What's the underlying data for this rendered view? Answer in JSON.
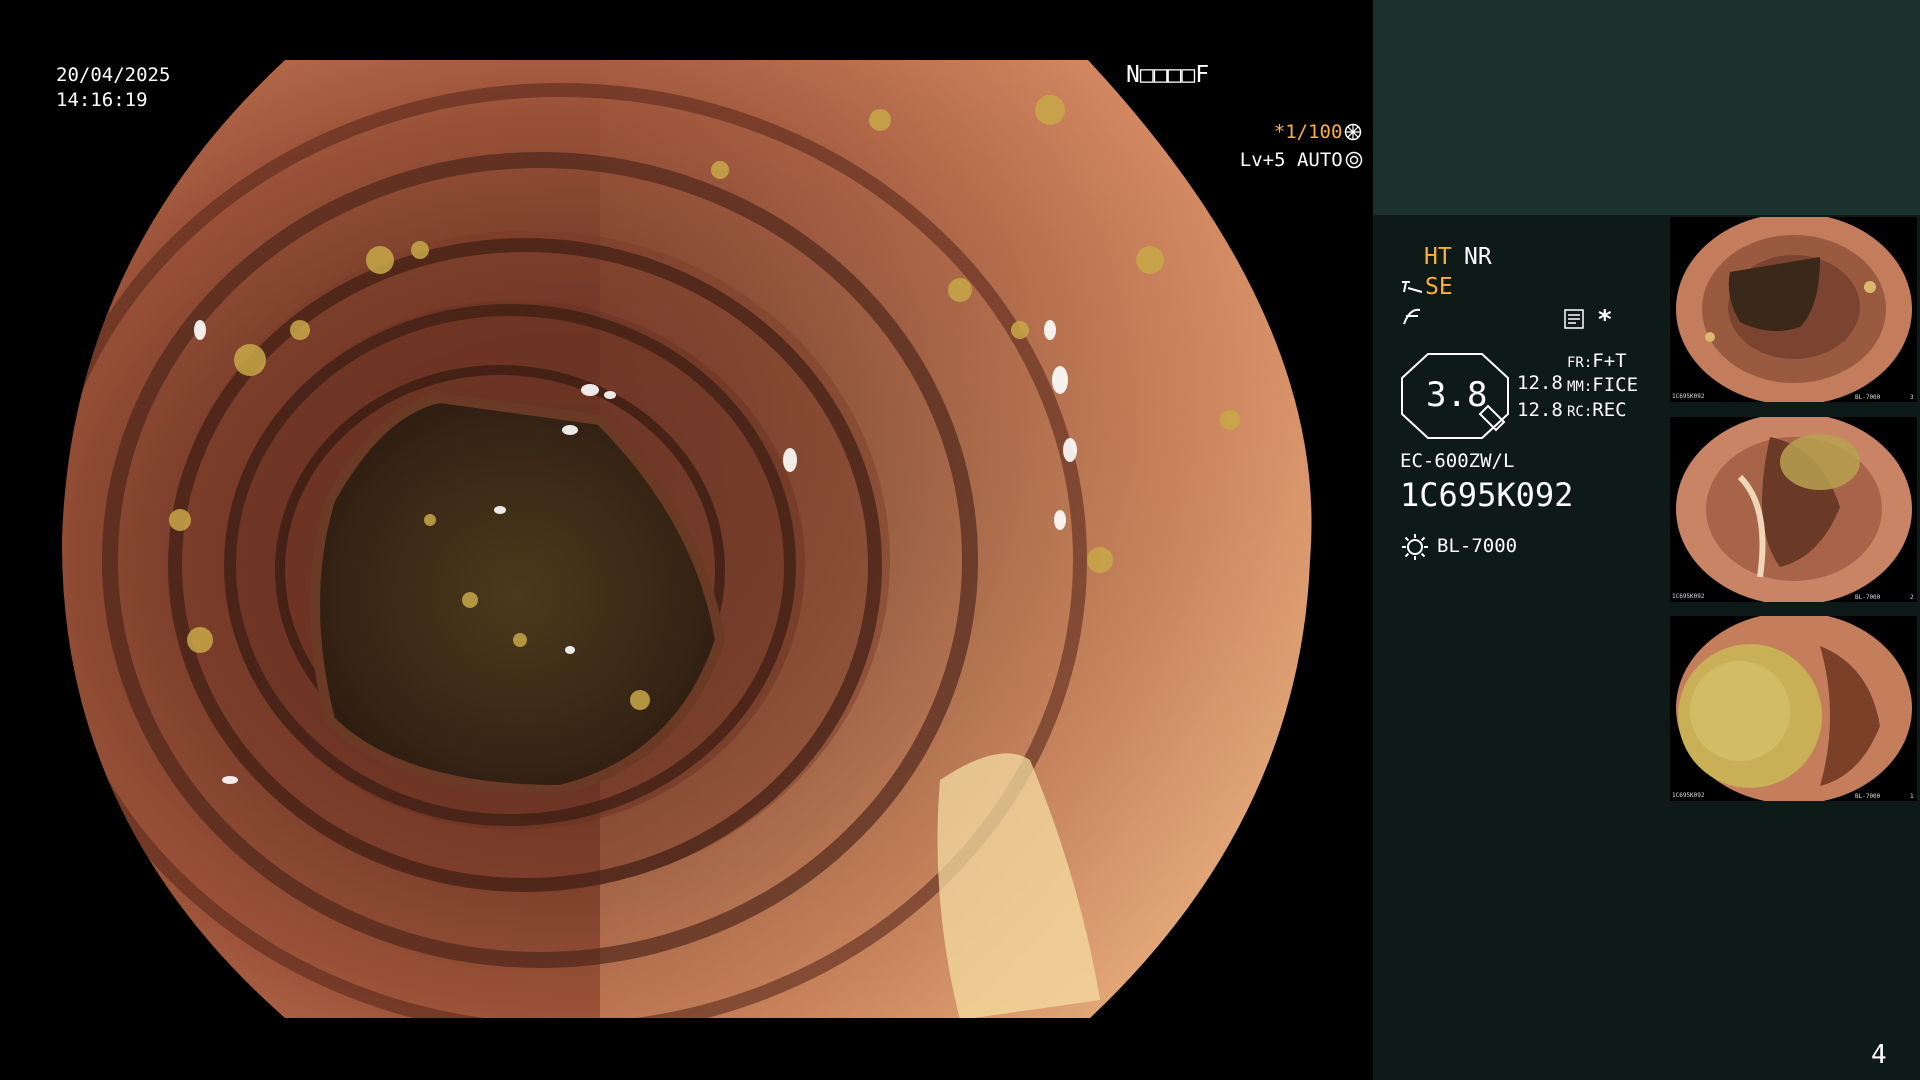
{
  "overlay": {
    "date": "20/04/2025",
    "time": "14:16:19",
    "patient_code": "N□□□□F",
    "shutter": "*1/100",
    "level": "Lv+5",
    "mode": "AUTO"
  },
  "panel": {
    "ht": "HT",
    "nr": "NR",
    "se": "SE",
    "asterisk": "*",
    "zoom_value": "3.8",
    "stat_top": "12.8",
    "stat_bottom": "12.8",
    "fr_label": "FR:",
    "fr_value": "F+T",
    "mm_label": "MM:",
    "mm_value": "FICE",
    "rc_label": "RC:",
    "rc_value": "REC",
    "scope_model": "EC-600ZW/L",
    "serial": "1C695K092",
    "light_source": "BL-7000",
    "page_number": "4"
  },
  "thumbnails": [
    {
      "index": "3",
      "serial": "1C695K092",
      "light": "BL-7000"
    },
    {
      "index": "2",
      "serial": "1C695K092",
      "light": "BL-7000"
    },
    {
      "index": "1",
      "serial": "1C695K092",
      "light": "BL-7000"
    }
  ],
  "colors": {
    "panel_bg": "#0e1a18",
    "panel_top_bg": "#1b312e",
    "accent_orange": "#ffb030"
  },
  "icons": [
    "shutter-icon",
    "auto-iris-icon",
    "structure-enhance-icon",
    "color-tone-icon",
    "memo-icon",
    "light-source-icon",
    "zoom-octagon-icon"
  ]
}
